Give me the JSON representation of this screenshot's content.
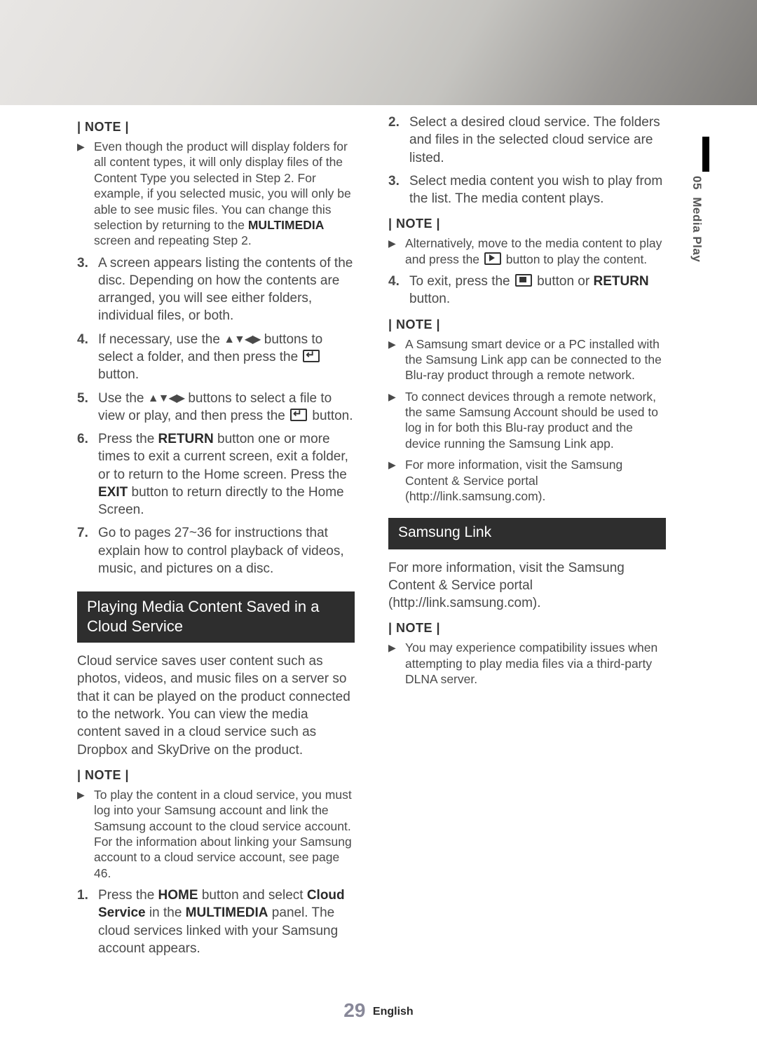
{
  "sideTab": {
    "chapter_num": "05",
    "chapter_title": "Media Play"
  },
  "footer": {
    "page_num": "29",
    "lang": "English"
  },
  "section_cloud_title": "Playing Media Content Saved in a Cloud Service",
  "section_link_title": "Samsung Link",
  "left": {
    "note1_label": "| NOTE |",
    "note1_b1": "Even though the product will display folders for all content types, it will only display files of the Content Type you selected in Step 2. For example, if you selected music, you will only be able to see music files. You can change this selection by returning to the ",
    "note1_b1_bold": "MULTIMEDIA",
    "note1_b1_tail": " screen and repeating Step 2.",
    "s3_num": "3.",
    "s3_txt": "A screen appears listing the contents of the disc. Depending on how the contents are arranged, you will see either folders, individual files, or both.",
    "s4_num": "4.",
    "s4_a": "If necessary, use the ",
    "s4_b": " buttons to select a folder, and then press the ",
    "s4_c": " button.",
    "s5_num": "5.",
    "s5_a": "Use the ",
    "s5_b": " buttons to select a file to view or play, and then press the ",
    "s5_c": " button.",
    "s6_num": "6.",
    "s6_a": "Press the ",
    "s6_return": "RETURN",
    "s6_b": " button one or more times to exit a current screen, exit a folder, or to return to the Home screen. Press the ",
    "s6_exit": "EXIT",
    "s6_c": " button to return directly to the Home Screen.",
    "s7_num": "7.",
    "s7_txt": "Go to pages 27~36 for instructions that explain how to control playback of videos, music, and pictures on a disc.",
    "cloud_intro": "Cloud service saves user content such as photos, videos, and music files on a server so that it can be played on the product connected to the network. You can view the media content saved in a cloud service such as Dropbox and SkyDrive on the product.",
    "note2_label": "| NOTE |",
    "note2_b1": "To play the content in a cloud service, you must log into your Samsung account and link the Samsung account to the cloud service account. For the information about linking your Samsung account to a cloud service account, see page 46.",
    "c1_num": "1.",
    "c1_a": "Press the ",
    "c1_home": "HOME",
    "c1_b": " button and select ",
    "c1_cs": "Cloud Service",
    "c1_c": " in the ",
    "c1_mm": "MULTIMEDIA",
    "c1_d": " panel. The cloud services linked with your Samsung account appears."
  },
  "right": {
    "c2_num": "2.",
    "c2_txt": "Select a desired cloud service. The folders and files in the selected cloud service are listed.",
    "c3_num": "3.",
    "c3_txt": "Select media content you wish to play from the list. The media content plays.",
    "noteA_label": "| NOTE |",
    "noteA_a": "Alternatively, move to the media content to play and press the ",
    "noteA_b": " button to play the content.",
    "c4_num": "4.",
    "c4_a": "To exit, press the ",
    "c4_b": " button or ",
    "c4_return": "RETURN",
    "c4_c": " button.",
    "noteB_label": "| NOTE |",
    "noteB_b1": "A Samsung smart device or a PC installed with the Samsung Link  app can be connected to the Blu-ray product through a remote network.",
    "noteB_b2": "To connect devices through a remote network, the same Samsung Account should be used to log in for both this Blu-ray product and the device running the Samsung Link app.",
    "noteB_b3": "For more information, visit the Samsung Content & Service portal (http://link.samsung.com).",
    "link_intro": "For more information, visit the Samsung Content & Service portal (http://link.samsung.com).",
    "noteC_label": "| NOTE |",
    "noteC_b1": "You may experience compatibility issues when attempting to play media files via a third-party DLNA server."
  }
}
